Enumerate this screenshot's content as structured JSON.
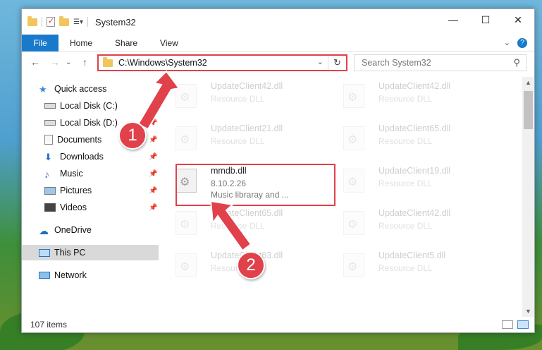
{
  "window": {
    "title": "System32",
    "controls": {
      "minimize": "—",
      "maximize": "☐",
      "close": "✕"
    }
  },
  "ribbon": {
    "tabs": [
      "File",
      "Home",
      "Share",
      "View"
    ],
    "right": {
      "expand": "⌄",
      "help": "?"
    }
  },
  "navbar": {
    "back": "←",
    "forward": "→",
    "recent": "⌄",
    "up": "↑",
    "address": "C:\\Windows\\System32",
    "address_dropdown": "⌄",
    "refresh": "↻",
    "search_placeholder": "Search System32",
    "search_icon": "⚲"
  },
  "sidebar": {
    "items": [
      {
        "label": "Quick access",
        "icon": "star-icon"
      },
      {
        "label": "Local Disk (C:)",
        "icon": "drive-icon",
        "pinned": true
      },
      {
        "label": "Local Disk (D:)",
        "icon": "drive-icon",
        "pinned": true
      },
      {
        "label": "Documents",
        "icon": "documents-icon",
        "pinned": true
      },
      {
        "label": "Downloads",
        "icon": "download-icon",
        "pinned": true
      },
      {
        "label": "Music",
        "icon": "music-icon",
        "pinned": true
      },
      {
        "label": "Pictures",
        "icon": "pictures-icon",
        "pinned": true
      },
      {
        "label": "Videos",
        "icon": "videos-icon",
        "pinned": true
      },
      {
        "label": "OneDrive",
        "icon": "cloud-icon"
      },
      {
        "label": "This PC",
        "icon": "pc-icon",
        "selected": true
      },
      {
        "label": "Network",
        "icon": "network-icon"
      }
    ],
    "pin_glyph": "📌"
  },
  "files": [
    {
      "name": "UpdateClient42.dll",
      "desc": "Resource DLL",
      "faded": true
    },
    {
      "name": "UpdateClient42.dll",
      "desc": "Resource DLL",
      "faded": true
    },
    {
      "name": "UpdateClient21.dll",
      "desc": "Resource DLL",
      "faded": true
    },
    {
      "name": "UpdateClient65.dll",
      "desc": "Resource DLL",
      "faded": true
    },
    {
      "name": "mmdb.dll",
      "desc": "8.10.2.26",
      "desc2": "Music libraray and ...",
      "faded": false
    },
    {
      "name": "UpdateClient19.dll",
      "desc": "Resource DLL",
      "faded": true
    },
    {
      "name": "UpdateClient65.dll",
      "desc": "Resource DLL",
      "faded": true
    },
    {
      "name": "UpdateClient42.dll",
      "desc": "Resource DLL",
      "faded": true
    },
    {
      "name": "UpdateClient63.dll",
      "desc": "Resource DLL",
      "faded": true
    },
    {
      "name": "UpdateClient5.dll",
      "desc": "Resource DLL",
      "faded": true
    }
  ],
  "status": {
    "count": "107 items"
  },
  "annotations": {
    "badge1": "1",
    "badge2": "2",
    "color": "#e0414a"
  }
}
